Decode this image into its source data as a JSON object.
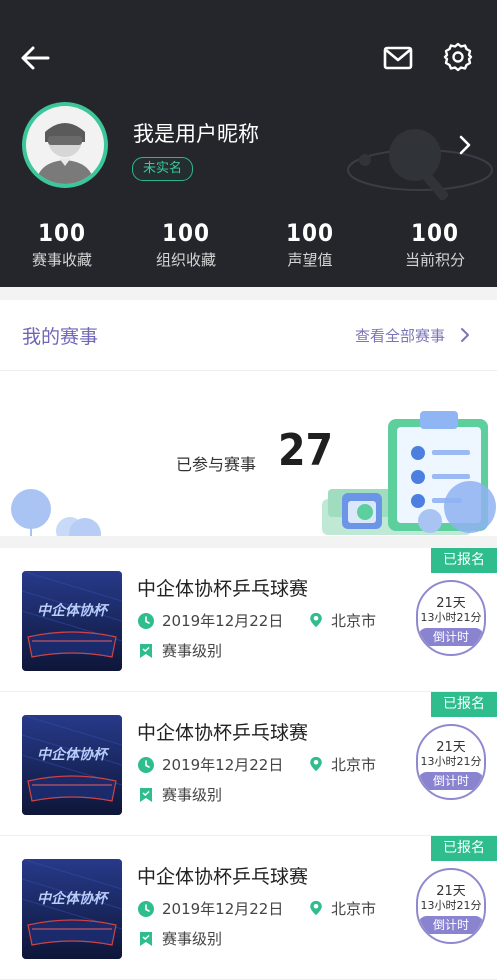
{
  "header": {
    "nickname": "我是用户昵称",
    "realname_badge": "未实名",
    "icons": {
      "back": "arrow-left-icon",
      "mail": "mail-icon",
      "settings": "gear-icon",
      "chevron": "chevron-right-icon"
    },
    "stats": [
      {
        "value": "100",
        "label": "赛事收藏"
      },
      {
        "value": "100",
        "label": "组织收藏"
      },
      {
        "value": "100",
        "label": "声望值"
      },
      {
        "value": "100",
        "label": "当前积分"
      }
    ]
  },
  "my_events": {
    "title": "我的赛事",
    "view_all": "查看全部赛事"
  },
  "summary": {
    "label": "已参与赛事",
    "count": "27"
  },
  "events": [
    {
      "title": "中企体协杯乒乓球赛",
      "date": "2019年12月22日",
      "city": "北京市",
      "level": "赛事级别",
      "badge": "已报名",
      "days": "21天",
      "hours_minutes": "13小时21分",
      "countdown_label": "倒计时",
      "thumb_text": "中企体协杯"
    },
    {
      "title": "中企体协杯乒乓球赛",
      "date": "2019年12月22日",
      "city": "北京市",
      "level": "赛事级别",
      "badge": "已报名",
      "days": "21天",
      "hours_minutes": "13小时21分",
      "countdown_label": "倒计时",
      "thumb_text": "中企体协杯"
    },
    {
      "title": "中企体协杯乒乓球赛",
      "date": "2019年12月22日",
      "city": "北京市",
      "level": "赛事级别",
      "badge": "已报名",
      "days": "21天",
      "hours_minutes": "13小时21分",
      "countdown_label": "倒计时",
      "thumb_text": "中企体协杯"
    }
  ],
  "colors": {
    "header_bg": "#24262b",
    "accent_green": "#2fbd8d",
    "accent_purple": "#8a83cf",
    "title_purple": "#6f67b6"
  }
}
